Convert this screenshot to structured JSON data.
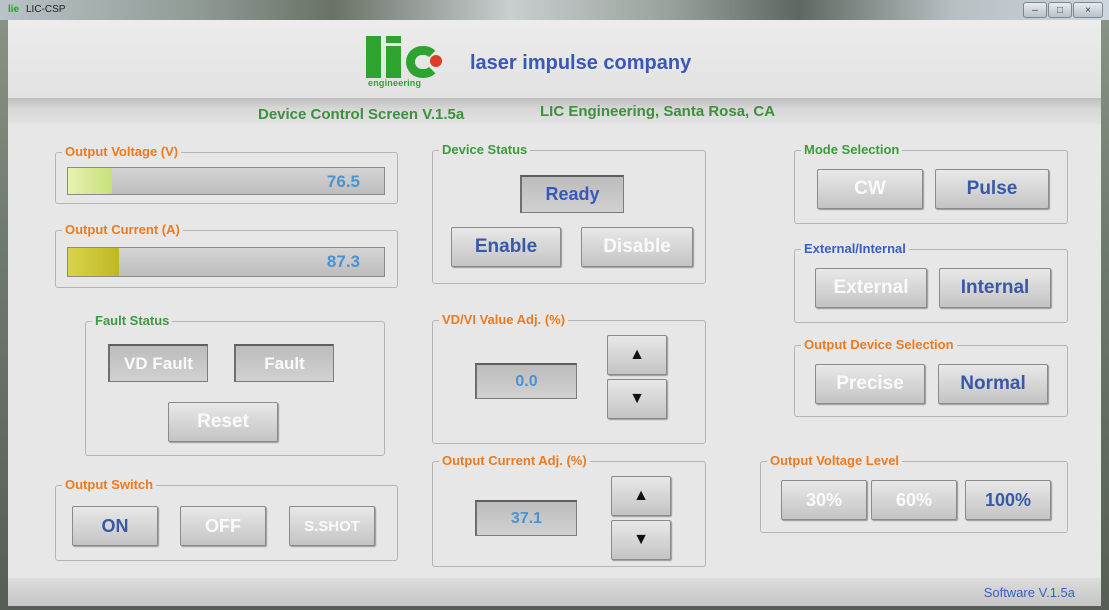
{
  "window": {
    "title": "LIC-CSP",
    "icon_label": "lie",
    "minimize_icon": "minimize-icon",
    "maximize_icon": "maximize-icon",
    "close_icon": "close-icon"
  },
  "header": {
    "logo_text": "lic",
    "logo_sub": "engineering",
    "company_name": "laser impulse company",
    "screen_title": "Device Control Screen V.1.5a",
    "location": "LIC Engineering, Santa Rosa, CA"
  },
  "output_voltage": {
    "title": "Output Voltage (V)",
    "value": "76.5",
    "fill_fraction": 0.14
  },
  "output_current": {
    "title": "Output Current (A)",
    "value": "87.3",
    "fill_fraction": 0.16
  },
  "fault_status": {
    "title": "Fault Status",
    "vd_fault": "VD Fault",
    "fault": "Fault",
    "reset": "Reset"
  },
  "output_switch": {
    "title": "Output Switch",
    "on": "ON",
    "off": "OFF",
    "sshot": "S.SHOT"
  },
  "device_status": {
    "title": "Device Status",
    "status": "Ready",
    "enable": "Enable",
    "disable": "Disable"
  },
  "vdvi_adj": {
    "title": "VD/VI Value Adj. (%)",
    "value": "0.0",
    "up": "▲",
    "down": "▼"
  },
  "current_adj": {
    "title": "Output Current Adj. (%)",
    "value": "37.1",
    "up": "▲",
    "down": "▼"
  },
  "mode_selection": {
    "title": "Mode Selection",
    "cw": "CW",
    "pulse": "Pulse"
  },
  "ext_int": {
    "title": "External/Internal",
    "external": "External",
    "internal": "Internal"
  },
  "output_device": {
    "title": "Output Device Selection",
    "precise": "Precise",
    "normal": "Normal"
  },
  "voltage_level": {
    "title": "Output Voltage Level",
    "p30": "30%",
    "p60": "60%",
    "p100": "100%"
  },
  "footer": {
    "software_version": "Software  V.1.5a"
  },
  "colors": {
    "accent_orange": "#ee7a1e",
    "accent_green": "#3e9a3e",
    "accent_blue": "#3a5ec0"
  }
}
